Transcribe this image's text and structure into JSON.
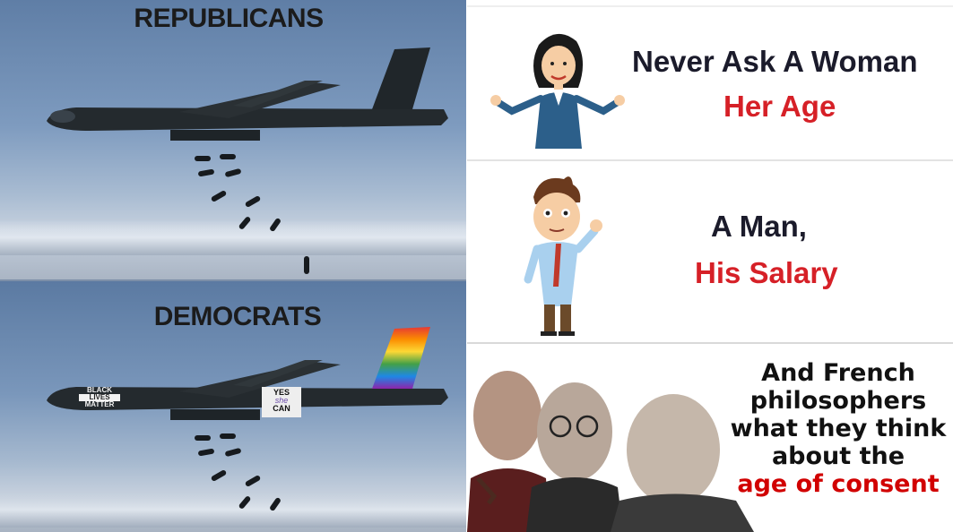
{
  "left_meme": {
    "top_caption": "REPUBLICANS",
    "bottom_caption": "DEMOCRATS",
    "nose_text": [
      "BLACK",
      "LIVES",
      "MATTER"
    ],
    "tail_text": [
      "YES",
      "she",
      "CAN"
    ]
  },
  "right_meme": {
    "panel1": {
      "line1": "Never Ask A Woman",
      "line2": "Her Age"
    },
    "panel2": {
      "line1": "A Man,",
      "line2": "His Salary"
    },
    "panel3": {
      "lines": [
        "And French",
        "philosophers",
        "what they think",
        "about the"
      ],
      "highlight": "age of consent"
    }
  },
  "colors": {
    "text_dark": "#1b1b2b",
    "accent_red": "#d62027",
    "consent_red": "#d10000",
    "sky": "#7e9bbf"
  }
}
